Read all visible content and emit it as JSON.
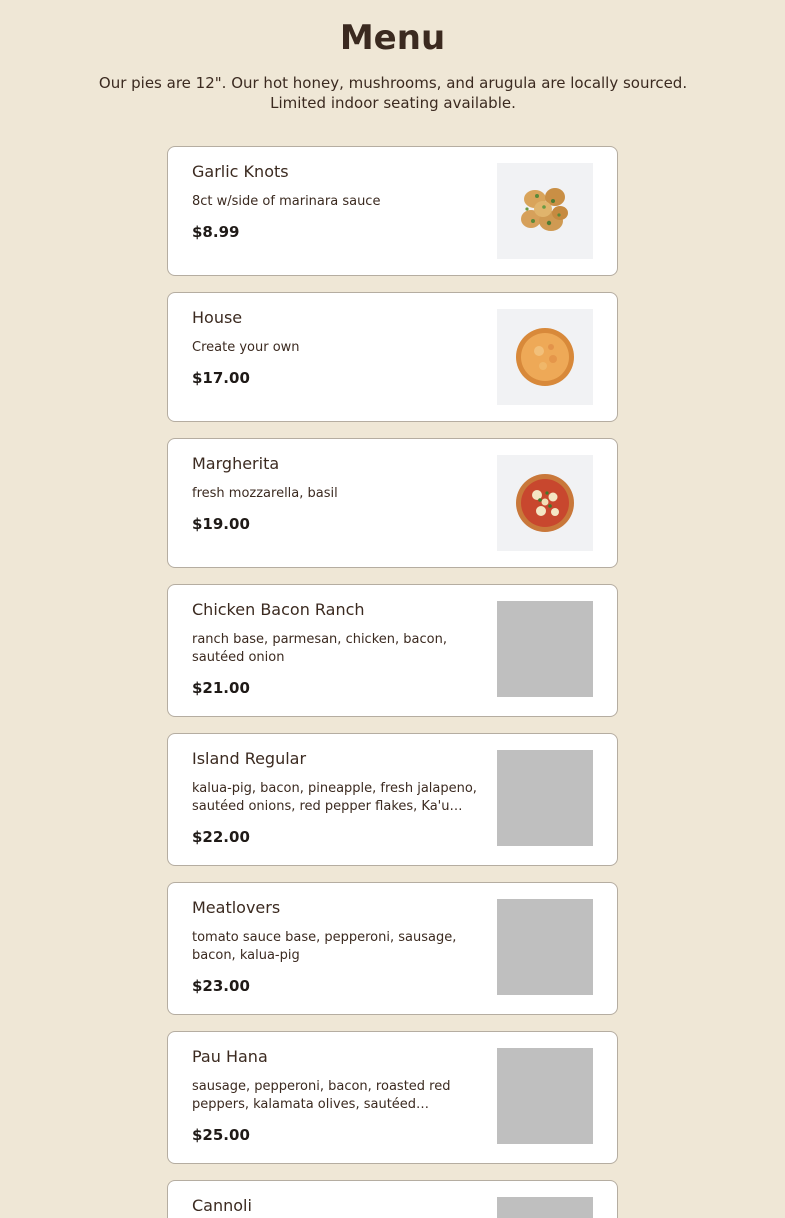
{
  "header": {
    "title": "Menu",
    "intro": "Our pies are 12\". Our hot honey, mushrooms, and arugula are locally sourced. Limited indoor seating available."
  },
  "items": [
    {
      "name": "Garlic Knots",
      "description": "8ct w/side of marinara sauce",
      "price": "$8.99",
      "image": "garlic-knots-photo"
    },
    {
      "name": "House",
      "description": "Create your own",
      "price": "$17.00",
      "image": "cheese-pizza-photo"
    },
    {
      "name": "Margherita",
      "description": "fresh mozzarella, basil",
      "price": "$19.00",
      "image": "margherita-pizza-photo"
    },
    {
      "name": "Chicken Bacon Ranch",
      "description": "ranch base, parmesan, chicken, bacon, sautéed onion",
      "price": "$21.00",
      "image": "placeholder"
    },
    {
      "name": "Island Regular",
      "description": "kalua-pig, bacon, pineapple, fresh jalapeno, sautéed onions, red pepper flakes, Ka'u honey",
      "price": "$22.00",
      "image": "placeholder"
    },
    {
      "name": "Meatlovers",
      "description": "tomato sauce base, pepperoni, sausage, bacon, kalua-pig",
      "price": "$23.00",
      "image": "placeholder"
    },
    {
      "name": "Pau Hana",
      "description": "sausage, pepperoni, bacon, roasted red peppers, kalamata olives, sautéed Hamakua...",
      "price": "$25.00",
      "image": "placeholder"
    },
    {
      "name": "Cannoli",
      "description": "",
      "price": "",
      "image": "placeholder"
    }
  ]
}
